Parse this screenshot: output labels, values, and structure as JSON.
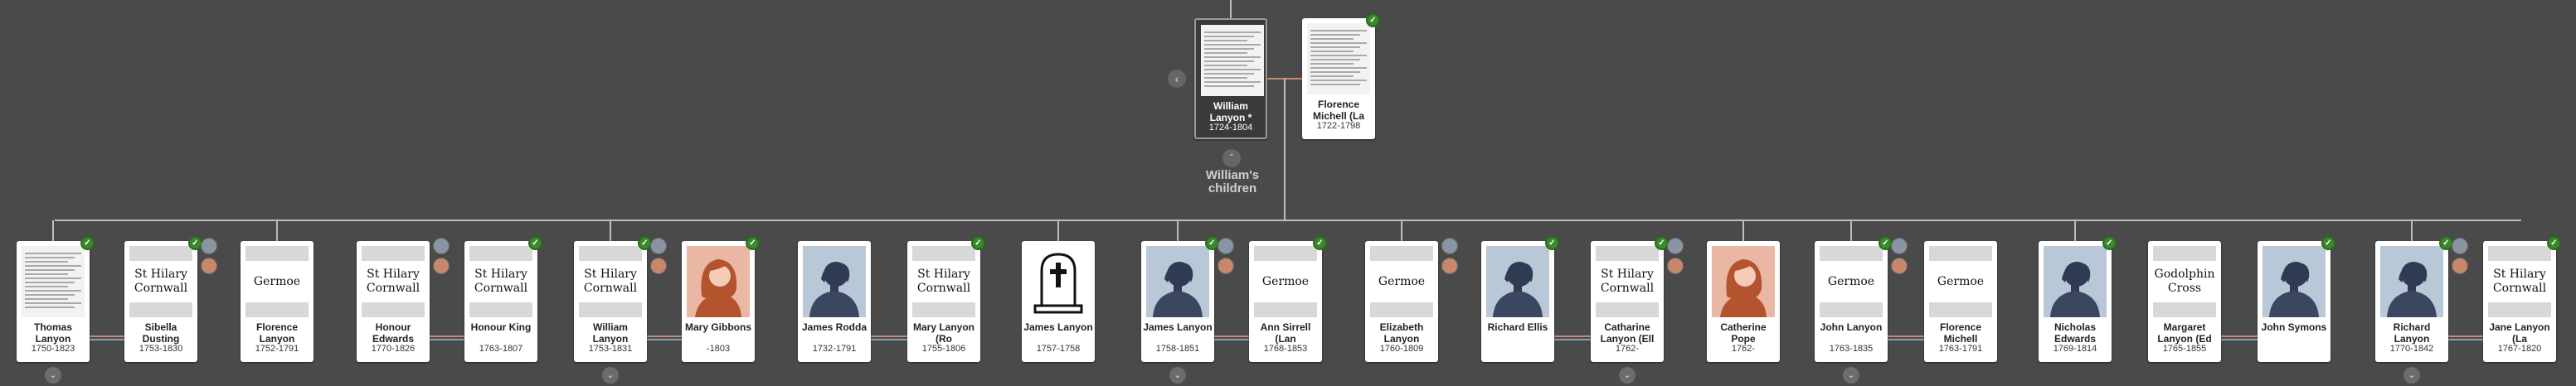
{
  "parents": [
    {
      "name": "William Lanyon *",
      "years": "1724-1804",
      "photo": "document"
    },
    {
      "name": "Florence Michell (La",
      "years": "1722-1798",
      "photo": "document"
    }
  ],
  "children_label": "William's children",
  "people": [
    {
      "name": "Thomas Lanyon",
      "years": "1750-1823",
      "photo": "document"
    },
    {
      "name": "Sibella Dusting",
      "years": "1753-1830",
      "photo": "place",
      "place": "St Hilary Cornwall"
    },
    {
      "name": "Florence Lanyon",
      "years": "1752-1791",
      "photo": "place",
      "place": "Germoe"
    },
    {
      "name": "Honour Edwards",
      "years": "1770-1826",
      "photo": "place",
      "place": "St Hilary Cornwall"
    },
    {
      "name": "Honour King",
      "years": "1763-1807",
      "photo": "place",
      "place": "St Hilary Cornwall"
    },
    {
      "name": "William Lanyon",
      "years": "1753-1831",
      "photo": "place",
      "place": "St Hilary Cornwall"
    },
    {
      "name": "Mary Gibbons",
      "years": "-1803",
      "photo": "female"
    },
    {
      "name": "James Rodda",
      "years": "1732-1791",
      "photo": "male"
    },
    {
      "name": "Mary Lanyon (Ro",
      "years": "1755-1806",
      "photo": "place",
      "place": "St Hilary Cornwall"
    },
    {
      "name": "James Lanyon",
      "years": "1757-1758",
      "photo": "grave"
    },
    {
      "name": "James Lanyon",
      "years": "1758-1851",
      "photo": "male"
    },
    {
      "name": "Ann Sirrell (Lan",
      "years": "1768-1853",
      "photo": "place",
      "place": "Germoe"
    },
    {
      "name": "Elizabeth Lanyon",
      "years": "1760-1809",
      "photo": "place",
      "place": "Germoe"
    },
    {
      "name": "Richard Ellis",
      "years": "",
      "photo": "male"
    },
    {
      "name": "Catharine Lanyon (Ell",
      "years": "1762-",
      "photo": "place",
      "place": "St Hilary Cornwall"
    },
    {
      "name": "Catherine Pope",
      "years": "1762-",
      "photo": "female"
    },
    {
      "name": "John Lanyon",
      "years": "1763-1835",
      "photo": "place",
      "place": "Germoe"
    },
    {
      "name": "Florence Michell",
      "years": "1763-1791",
      "photo": "place",
      "place": "Germoe"
    },
    {
      "name": "Nicholas Edwards",
      "years": "1769-1814",
      "photo": "male"
    },
    {
      "name": "Margaret Lanyon (Ed",
      "years": "1765-1855",
      "photo": "place",
      "place": "Godolphin Cross"
    },
    {
      "name": "John Symons",
      "years": "",
      "photo": "male"
    },
    {
      "name": "Richard Lanyon",
      "years": "1770-1842",
      "photo": "male"
    },
    {
      "name": "Jane Lanyon (La",
      "years": "1767-1820",
      "photo": "place",
      "place": "St Hilary Cornwall"
    }
  ],
  "colors": {
    "background": "#4a4a4a",
    "badge": "#3a8a2c",
    "line": "#bdbdbd",
    "male_bg": "#b8c8d6",
    "female_bg": "#e9b7a4"
  }
}
